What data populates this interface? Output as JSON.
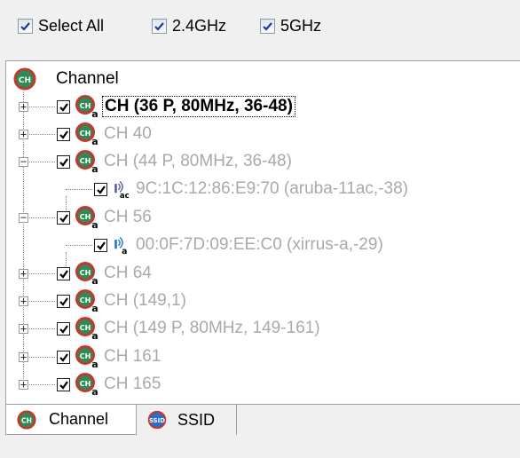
{
  "filters": {
    "select_all": {
      "label": "Select All",
      "checked": true
    },
    "band_24": {
      "label": "2.4GHz",
      "checked": true
    },
    "band_5": {
      "label": "5GHz",
      "checked": true
    }
  },
  "tree": {
    "root_label": "Channel",
    "nodes": [
      {
        "label": "CH (36 P, 80MHz, 36-48)",
        "expanded": false,
        "checked": true,
        "selected": true,
        "active": true
      },
      {
        "label": "CH 40",
        "expanded": false,
        "checked": true
      },
      {
        "label": "CH (44 P, 80MHz, 36-48)",
        "expanded": true,
        "checked": true,
        "children": [
          {
            "label": "9C:1C:12:86:E9:70 (aruba-11ac,-38)",
            "checked": true,
            "icon": "ac-ap-icon"
          }
        ]
      },
      {
        "label": "CH 56",
        "expanded": true,
        "checked": true,
        "children": [
          {
            "label": "00:0F:7D:09:EE:C0 (xirrus-a,-29)",
            "checked": true,
            "icon": "a-ap-icon"
          }
        ]
      },
      {
        "label": "CH 64",
        "expanded": false,
        "checked": true
      },
      {
        "label": "CH (149,1)",
        "expanded": false,
        "checked": true
      },
      {
        "label": "CH (149 P, 80MHz, 149-161)",
        "expanded": false,
        "checked": true
      },
      {
        "label": "CH 161",
        "expanded": false,
        "checked": true
      },
      {
        "label": "CH 165",
        "expanded": false,
        "checked": true
      }
    ]
  },
  "tabs": [
    {
      "label": "Channel",
      "icon": "channel-icon",
      "active": true
    },
    {
      "label": "SSID",
      "icon": "ssid-icon",
      "active": false
    }
  ],
  "colors": {
    "disabled_text": "#a9a9a9",
    "icon_ring": "#c0392b",
    "icon_fill": "#2e8b57"
  }
}
